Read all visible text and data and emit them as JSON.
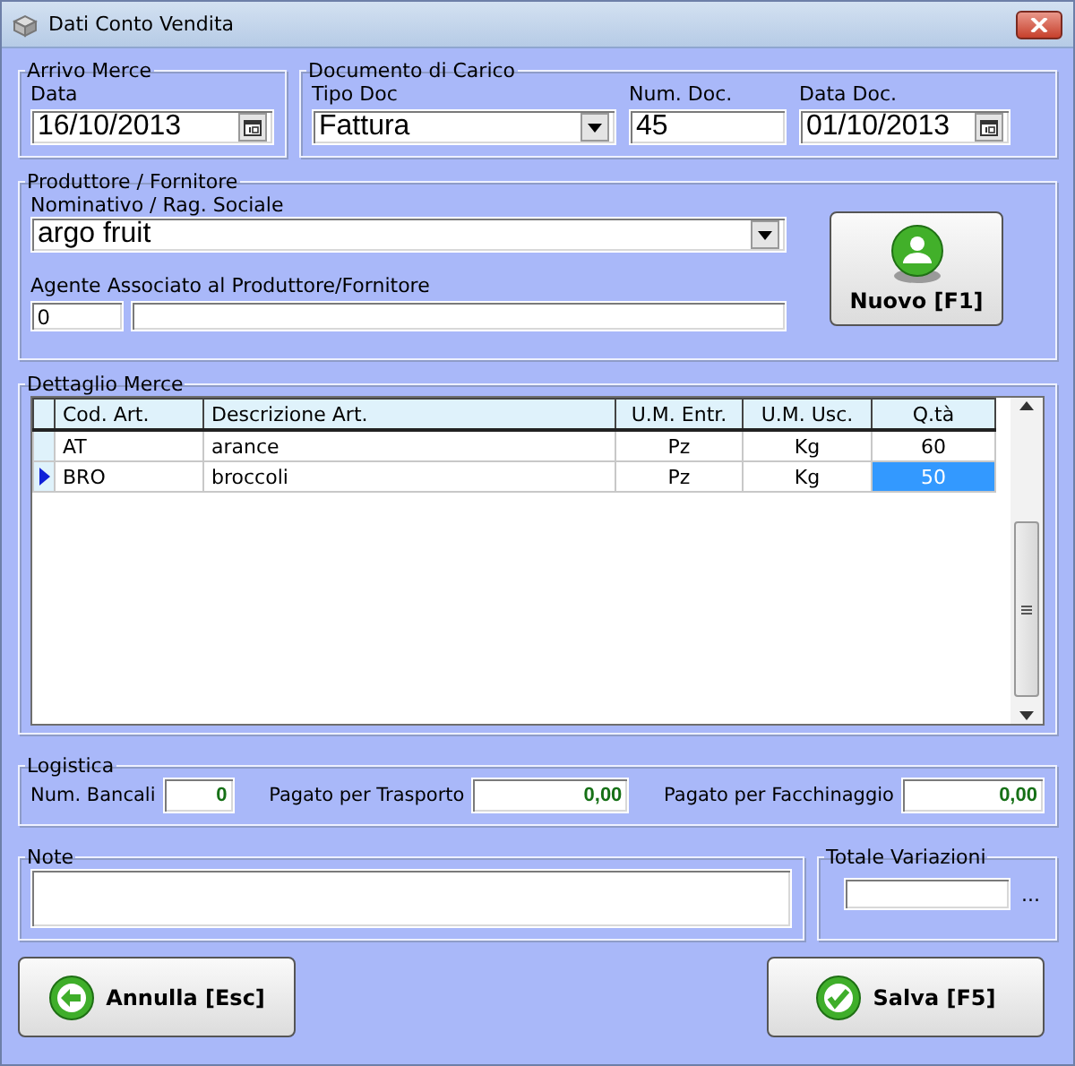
{
  "window": {
    "title": "Dati Conto Vendita"
  },
  "arrivo_merce": {
    "legend": "Arrivo Merce",
    "data_label": "Data",
    "data_value": "16/10/2013"
  },
  "documento": {
    "legend": "Documento di Carico",
    "tipo_label": "Tipo Doc",
    "tipo_value": "Fattura",
    "num_label": "Num. Doc.",
    "num_value": "45",
    "data_label": "Data Doc.",
    "data_value": "01/10/2013"
  },
  "produttore": {
    "legend": "Produttore / Fornitore",
    "nominativo_label": "Nominativo / Rag. Sociale",
    "nominativo_value": "argo fruit",
    "agente_label": "Agente Associato al Produttore/Fornitore",
    "agente_code": "0",
    "new_button": "Nuovo [F1]"
  },
  "dettaglio": {
    "legend": "Dettaglio Merce",
    "columns": [
      "Cod. Art.",
      "Descrizione Art.",
      "U.M. Entr.",
      "U.M. Usc.",
      "Q.tà"
    ],
    "rows": [
      {
        "cells": [
          "AT",
          "arance",
          "Pz",
          "Kg",
          "60"
        ],
        "selected": false
      },
      {
        "cells": [
          "BRO",
          "broccoli",
          "Pz",
          "Kg",
          "50"
        ],
        "selected": true
      }
    ]
  },
  "logistica": {
    "legend": "Logistica",
    "fields": [
      {
        "label": "Num. Bancali",
        "value": "0"
      },
      {
        "label": "Pagato per Trasporto",
        "value": "0,00"
      },
      {
        "label": "Pagato per Facchinaggio",
        "value": "0,00"
      }
    ]
  },
  "note": {
    "legend": "Note"
  },
  "totale": {
    "legend": "Totale Variazioni",
    "ellipsis": "..."
  },
  "buttons": [
    {
      "label": "Annulla [Esc]",
      "kind": "cancel"
    },
    {
      "label": "Salva [F5]",
      "kind": "save"
    }
  ]
}
